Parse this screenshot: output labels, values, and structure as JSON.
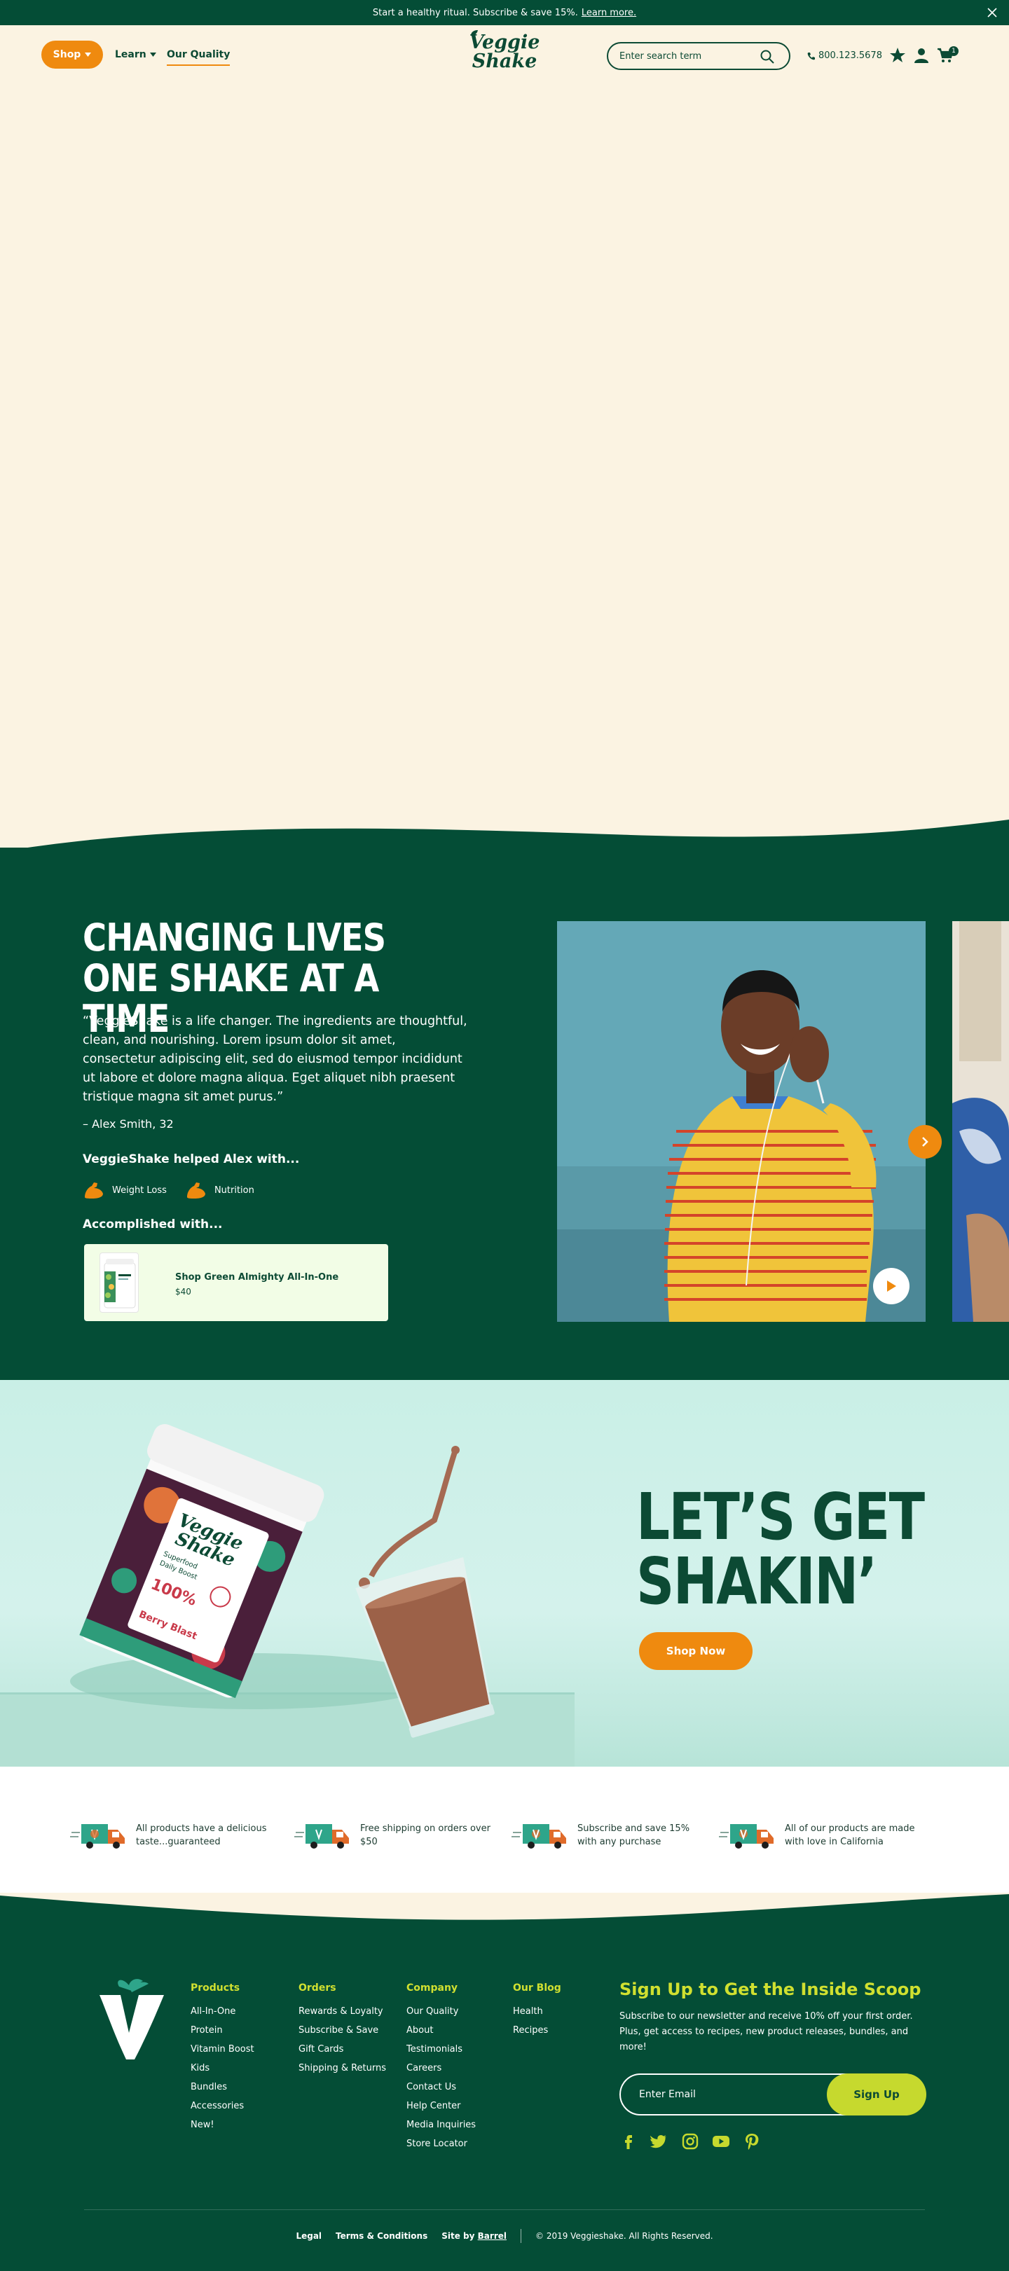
{
  "announcement": {
    "text": "Start a healthy ritual. Subscribe & save 15%.",
    "link": "Learn more."
  },
  "header": {
    "shop": "Shop",
    "learn": "Learn",
    "quality": "Our Quality",
    "logo_line1": "Veggie",
    "logo_line2": "Shake",
    "search_placeholder": "Enter search term",
    "phone": "800.123.5678",
    "cart_count": "1"
  },
  "testimonial": {
    "title": "CHANGING LIVES ONE SHAKE AT A TIME",
    "quote": "“VeggieShake is a life changer. The ingredients are thoughtful, clean, and nourishing. Lorem ipsum dolor sit amet, consectetur adipiscing elit, sed do eiusmod tempor incididunt ut labore et dolore magna aliqua. Eget aliquet nibh praesent tristique magna sit amet purus.”",
    "author": "– Alex Smith, 32",
    "helped_title": "VeggieShake helped Alex with...",
    "benefits": [
      "Weight Loss",
      "Nutrition"
    ],
    "accomplished_title": "Accomplished with...",
    "product": {
      "name": "Shop Green Almighty All-In-One",
      "price": "$40"
    }
  },
  "promo": {
    "title_line1": "LET’S GET",
    "title_line2": "SHAKIN’",
    "button": "Shop Now"
  },
  "features": [
    "All products have a delicious taste...guaranteed",
    "Free shipping on orders over $50",
    "Subscribe and save 15% with any purchase",
    "All of our products are made with love in California"
  ],
  "footer": {
    "columns": [
      {
        "title": "Products",
        "links": [
          "All-In-One",
          "Protein",
          "Vitamin Boost",
          "Kids",
          "Bundles",
          "Accessories",
          "New!"
        ]
      },
      {
        "title": "Orders",
        "links": [
          "Rewards & Loyalty",
          "Subscribe & Save",
          "Gift Cards",
          "Shipping & Returns"
        ]
      },
      {
        "title": "Company",
        "links": [
          "Our Quality",
          "About",
          "Testimonials",
          "Careers",
          "Contact Us",
          "Help Center",
          "Media Inquiries",
          "Store Locator"
        ]
      },
      {
        "title": "Our Blog",
        "links": [
          "Health",
          "Recipes"
        ]
      }
    ],
    "signup_title": "Sign Up to Get the Inside Scoop",
    "signup_text": "Subscribe to our newsletter and receive 10% off your first order. Plus, get access to recipes, new product releases, bundles, and more!",
    "email_placeholder": "Enter Email",
    "signup_button": "Sign Up",
    "social_icons": [
      "facebook-icon",
      "twitter-icon",
      "instagram-icon",
      "youtube-icon",
      "pinterest-icon"
    ],
    "legal": {
      "legal": "Legal",
      "terms": "Terms & Conditions",
      "site_by": "Site by",
      "barrel": "Barrel",
      "copyright": "© 2019 Veggieshake. All Rights Reserved."
    }
  },
  "colors": {
    "dark_green": "#044d36",
    "cream": "#fbf3e2",
    "orange": "#ef8a0f",
    "lime": "#c6d92e",
    "mint": "#c9efe6"
  }
}
